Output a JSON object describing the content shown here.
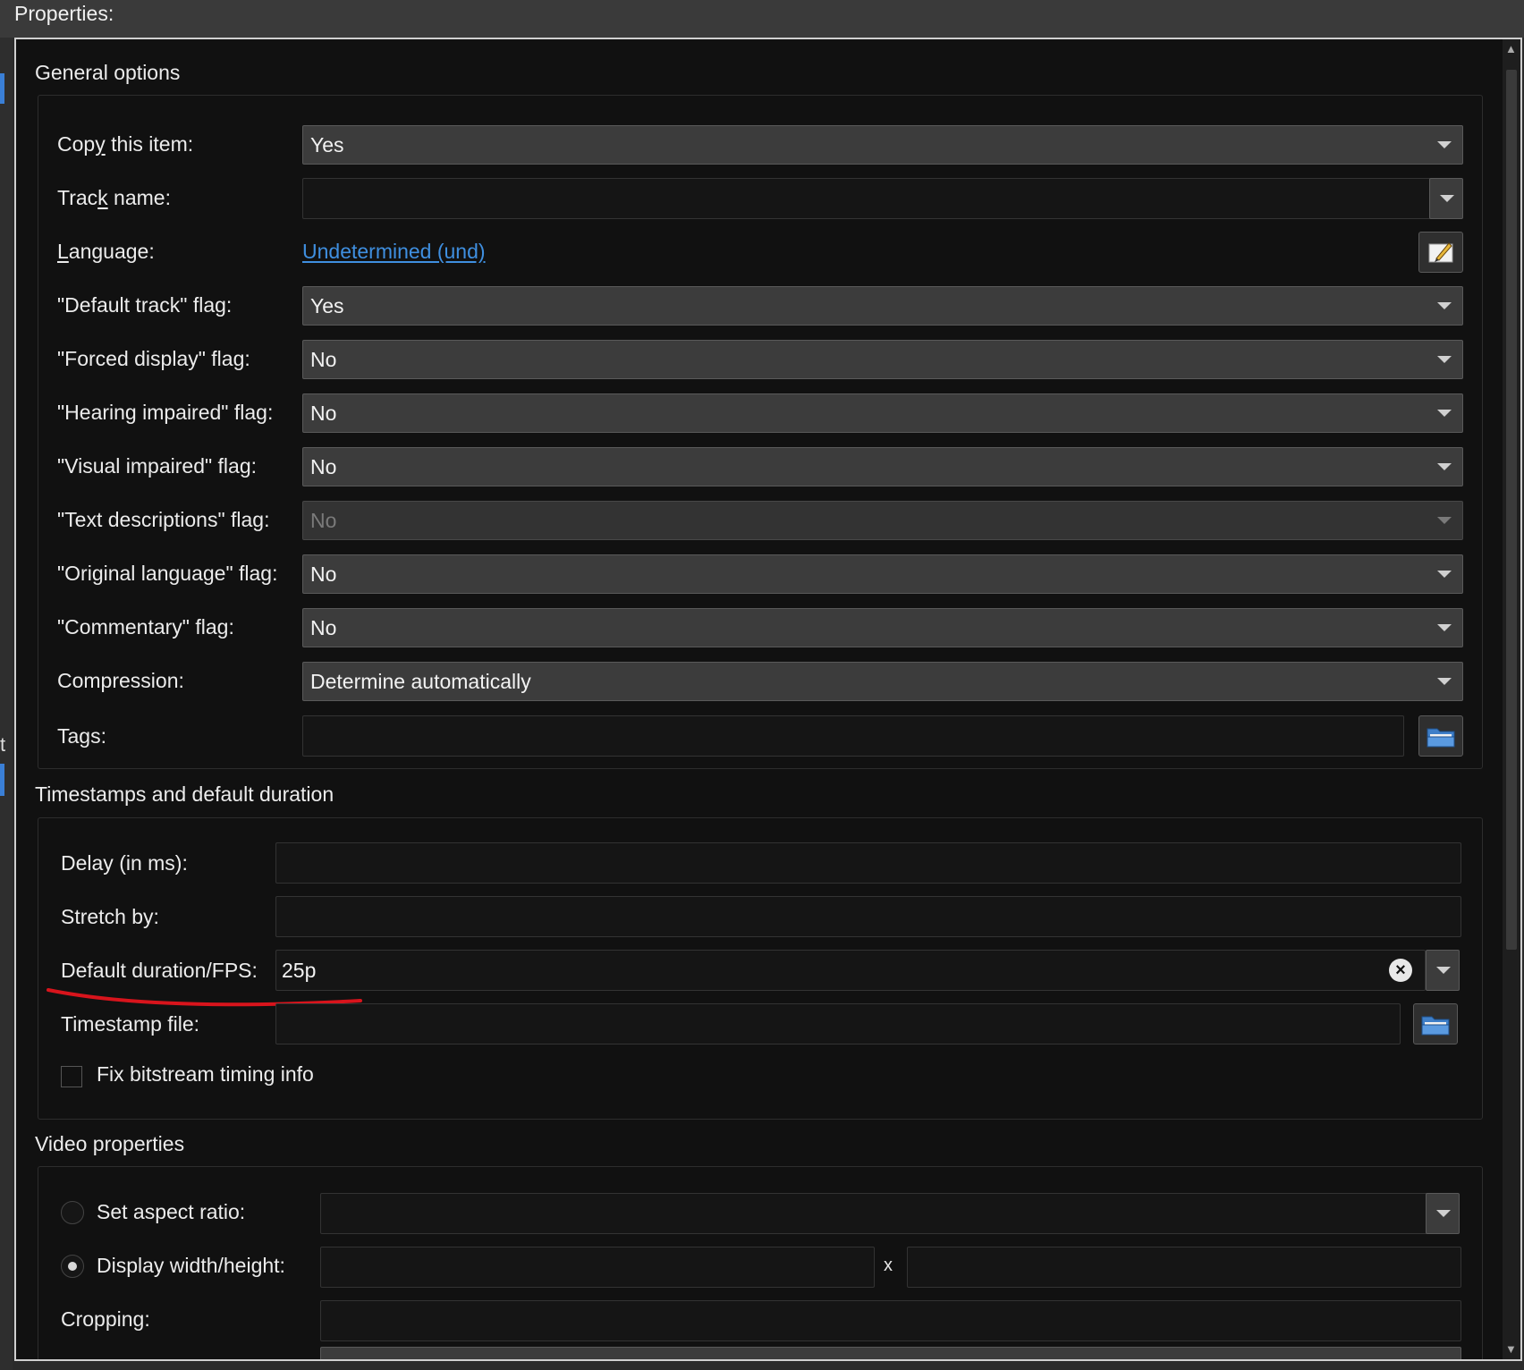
{
  "window": {
    "title": "Properties:"
  },
  "general": {
    "section_title": "General options",
    "copy_item": {
      "label_pre": "Cop",
      "label_mnemonic": "y",
      "label_post": " this item:",
      "value": "Yes"
    },
    "track_name": {
      "label_pre": "Trac",
      "label_mnemonic": "k",
      "label_post": " name:",
      "value": ""
    },
    "language": {
      "label_mnemonic": "L",
      "label_post": "anguage:",
      "value": "Undetermined (und)"
    },
    "default_track": {
      "label": "\"Default track\" flag:",
      "value": "Yes"
    },
    "forced_display": {
      "label": "\"Forced display\" flag:",
      "value": "No"
    },
    "hearing_impaired": {
      "label": "\"Hearing impaired\" flag:",
      "value": "No"
    },
    "visual_impaired": {
      "label": "\"Visual impaired\" flag:",
      "value": "No"
    },
    "text_descriptions": {
      "label": "\"Text descriptions\" flag:",
      "value": "No"
    },
    "original_language": {
      "label": "\"Original language\" flag:",
      "value": "No"
    },
    "commentary": {
      "label": "\"Commentary\" flag:",
      "value": "No"
    },
    "compression": {
      "label": "Compression:",
      "value": "Determine automatically"
    },
    "tags": {
      "label": "Tags:",
      "value": ""
    }
  },
  "timestamps": {
    "section_title": "Timestamps and default duration",
    "delay": {
      "label": "Delay (in ms):",
      "value": ""
    },
    "stretch": {
      "label": "Stretch by:",
      "value": ""
    },
    "default_duration": {
      "label": "Default duration/FPS:",
      "value": "25p"
    },
    "timestamp_file": {
      "label": "Timestamp file:",
      "value": ""
    },
    "fix_bitstream": {
      "label": "Fix bitstream timing info",
      "checked": false
    }
  },
  "video": {
    "section_title": "Video properties",
    "aspect_ratio": {
      "label": "Set aspect ratio:",
      "value": "",
      "selected": false
    },
    "display_wh": {
      "label": "Display width/height:",
      "separator": "x",
      "width": "",
      "height": "",
      "selected": true
    },
    "cropping": {
      "label": "Cropping:",
      "value": ""
    }
  },
  "annotation": {
    "color": "#d8141c"
  },
  "icons": [
    "edit-icon",
    "folder-icon",
    "clear-icon",
    "chevron-down-icon"
  ]
}
